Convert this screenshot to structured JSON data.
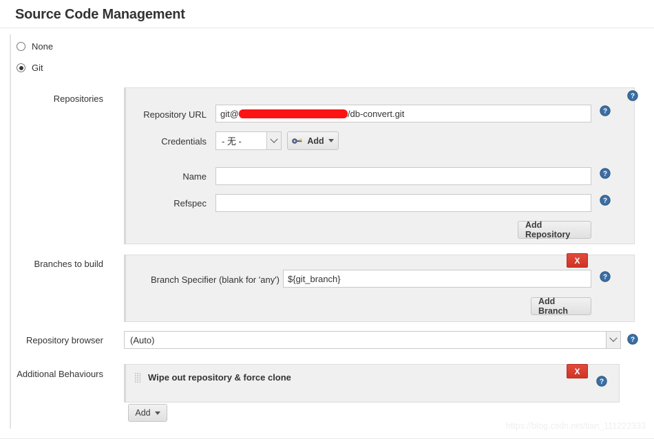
{
  "page": {
    "title": "Source Code Management",
    "watermark": "https://blog.csdn.net/tian_111222333"
  },
  "scm_choice": {
    "none_label": "None",
    "none_selected": false,
    "git_label": "Git",
    "git_selected": true
  },
  "sections": {
    "repositories_label": "Repositories",
    "branches_label": "Branches to build",
    "repository_browser_label": "Repository browser",
    "additional_behaviours_label": "Additional Behaviours"
  },
  "repository": {
    "url_label": "Repository URL",
    "url_prefix": "git@",
    "url_suffix": "/db-convert.git",
    "url_redacted": true,
    "credentials_label": "Credentials",
    "credentials_value": "- 无 -",
    "add_credentials_label": "Add",
    "name_label": "Name",
    "name_value": "",
    "refspec_label": "Refspec",
    "refspec_value": "",
    "add_repository_label": "Add Repository"
  },
  "branches": {
    "specifier_label": "Branch Specifier (blank for 'any')",
    "specifier_value": "${git_branch}",
    "add_branch_label": "Add Branch",
    "delete_label": "X"
  },
  "repository_browser": {
    "value": "(Auto)"
  },
  "additional_behaviours": {
    "items": [
      {
        "label": "Wipe out repository & force clone",
        "delete_label": "X"
      }
    ],
    "add_label": "Add"
  },
  "colors": {
    "delete_red": "#d43f30",
    "help_blue": "#3a6ea5",
    "redaction_red": "#fb1414",
    "panel_bg": "#f0f0f0"
  }
}
